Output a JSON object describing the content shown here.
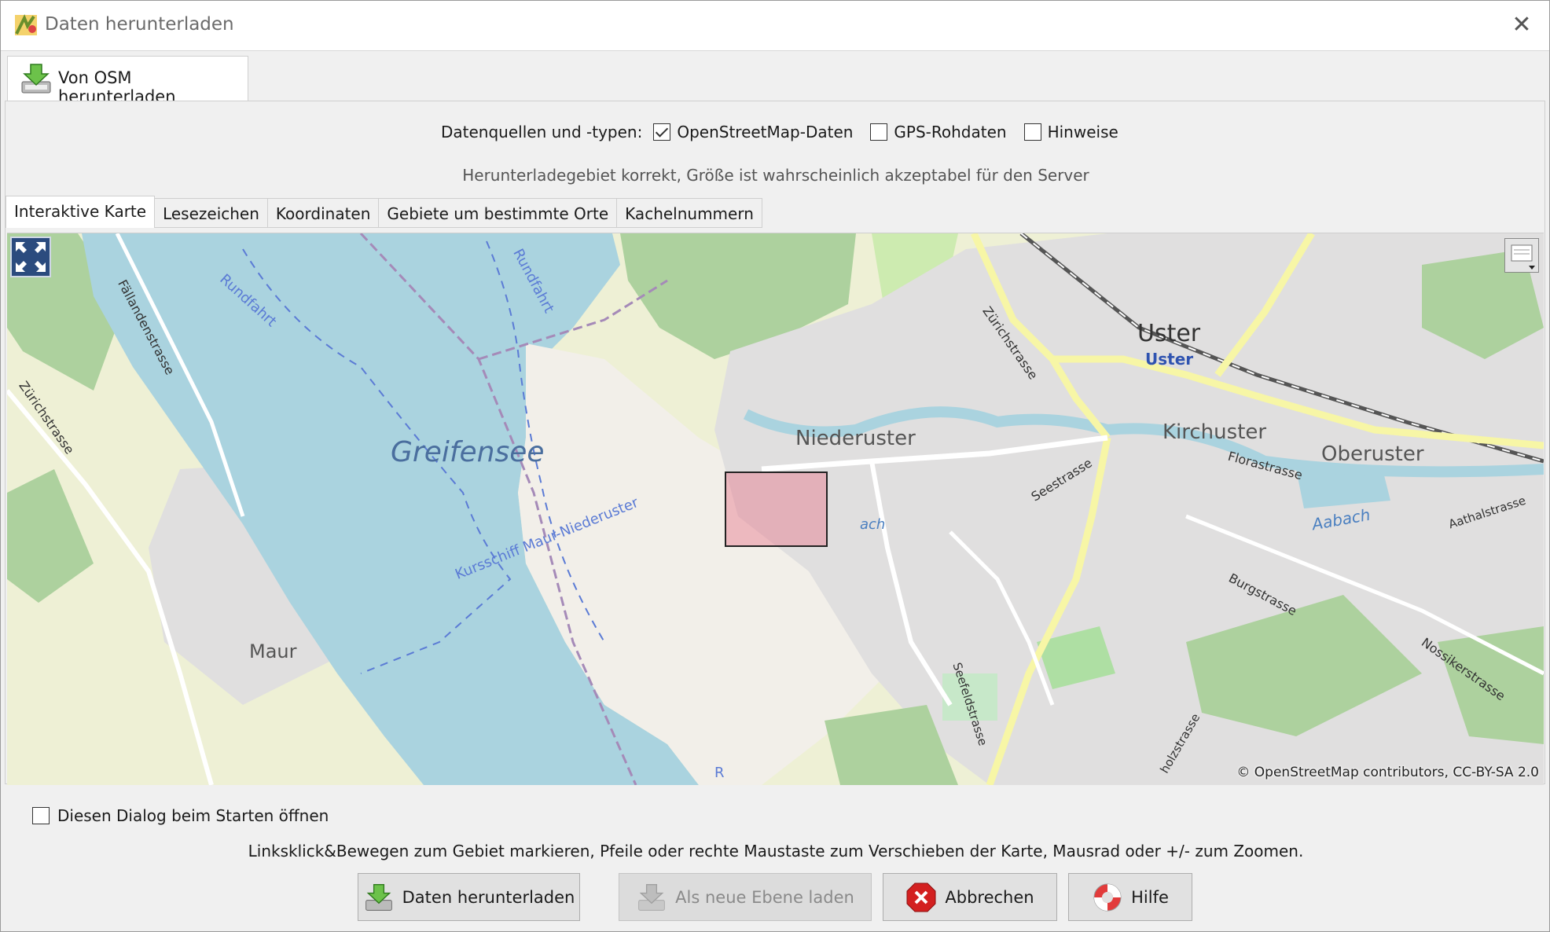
{
  "window": {
    "title": "Daten herunterladen",
    "close_icon": "close-icon",
    "app_icon": "josm-icon"
  },
  "top_tab": {
    "label": "Von OSM herunterladen",
    "icon": "download-icon"
  },
  "sources": {
    "label": "Datenquellen und -typen:",
    "options": [
      {
        "label": "OpenStreetMap-Daten",
        "checked": true
      },
      {
        "label": "GPS-Rohdaten",
        "checked": false
      },
      {
        "label": "Hinweise",
        "checked": false
      }
    ]
  },
  "status_text": "Herunterladegebiet korrekt, Größe ist wahrscheinlich akzeptabel für den Server",
  "tabs": [
    "Interaktive Karte",
    "Lesezeichen",
    "Koordinaten",
    "Gebiete um bestimmte Orte",
    "Kachelnummern"
  ],
  "active_tab": "Interaktive Karte",
  "map": {
    "labels": {
      "lake": "Greifensee",
      "rundfahrt1": "Rundfahrt",
      "rundfahrt2": "Rundfahrt",
      "faellanden": "Fällandenstrasse",
      "zuerich_w": "Zürichstrasse",
      "maur": "Maur",
      "kursschiff": "Kursschiff Maur-Niederuster",
      "niederuster": "Niederuster",
      "uster": "Uster",
      "uster_station": "Uster",
      "zuerich_e": "Zürichstrasse",
      "kirchuster": "Kirchuster",
      "oberuster": "Oberuster",
      "florastrasse": "Florastrasse",
      "seestrasse": "Seestrasse",
      "aabach": "Aabach",
      "aabach_fragment": "ach",
      "aathal": "Aathalstrasse",
      "burgstrasse": "Burgstrasse",
      "nossiker": "Nossikerstrasse",
      "seefeld": "Seefeldstrasse",
      "holz": "holzstrasse",
      "r_fragment": "R"
    },
    "attribution": "© OpenStreetMap contributors, CC-BY-SA 2.0",
    "colors": {
      "water": "#aad3df",
      "residential": "#e0dfdf",
      "forest": "#add19e",
      "farmland": "#eef0d5",
      "meadow": "#cdebb0",
      "selection": "#e6788c"
    }
  },
  "startup_checkbox": {
    "label": "Diesen Dialog beim Starten öffnen",
    "checked": false
  },
  "hint": "Linksklick&Bewegen zum Gebiet markieren, Pfeile oder rechte Maustaste zum Verschieben der Karte, Mausrad oder +/- zum Zoomen.",
  "buttons": {
    "download": "Daten herunterladen",
    "new_layer": "Als neue Ebene laden",
    "cancel": "Abbrechen",
    "help": "Hilfe"
  }
}
